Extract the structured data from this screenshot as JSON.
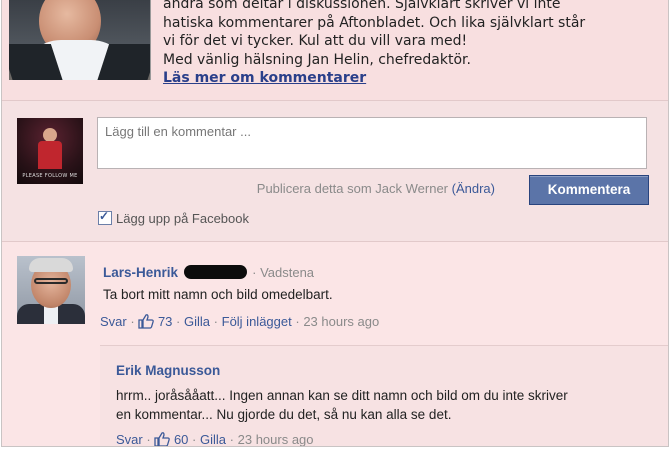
{
  "intro": {
    "line1": "andra som deltar i diskussionen. Självklart skriver vi inte",
    "line2": "hatiska kommentarer på Aftonbladet. Och lika självklart står",
    "line3": "vi för det vi tycker. Kul att du vill vara med!",
    "line4": "Med vänlig hälsning Jan Helin, chefredaktör.",
    "read_more": "Läs mer om kommentarer"
  },
  "composer": {
    "avatar_caption": "PLEASE FOLLOW ME",
    "placeholder": "Lägg till en kommentar ...",
    "publish_as": "Publicera detta som Jack Werner",
    "change": "(Ändra)",
    "submit": "Kommentera",
    "post_to_facebook": "Lägg upp på Facebook",
    "post_to_facebook_checked": true
  },
  "comments": [
    {
      "author": "Lars-Henrik",
      "location": "· Vadstena",
      "text": "Ta bort mitt namn och bild omedelbart.",
      "reply": "Svar",
      "likes": "73",
      "like": "Gilla",
      "follow": "Följ inlägget",
      "time": "23 hours ago"
    }
  ],
  "reply": {
    "author": "Erik Magnusson",
    "line1": "hrrm.. joråsååatt... Ingen annan kan se ditt namn och bild om du inte skriver",
    "line2": "en kommentar... Nu gjorde du det, så nu kan alla se det.",
    "reply": "Svar",
    "likes": "60",
    "like": "Gilla",
    "time": "23 hours ago"
  },
  "colors": {
    "background": "#fbe5e6",
    "link": "#3b5998",
    "button": "#5b74a8"
  }
}
